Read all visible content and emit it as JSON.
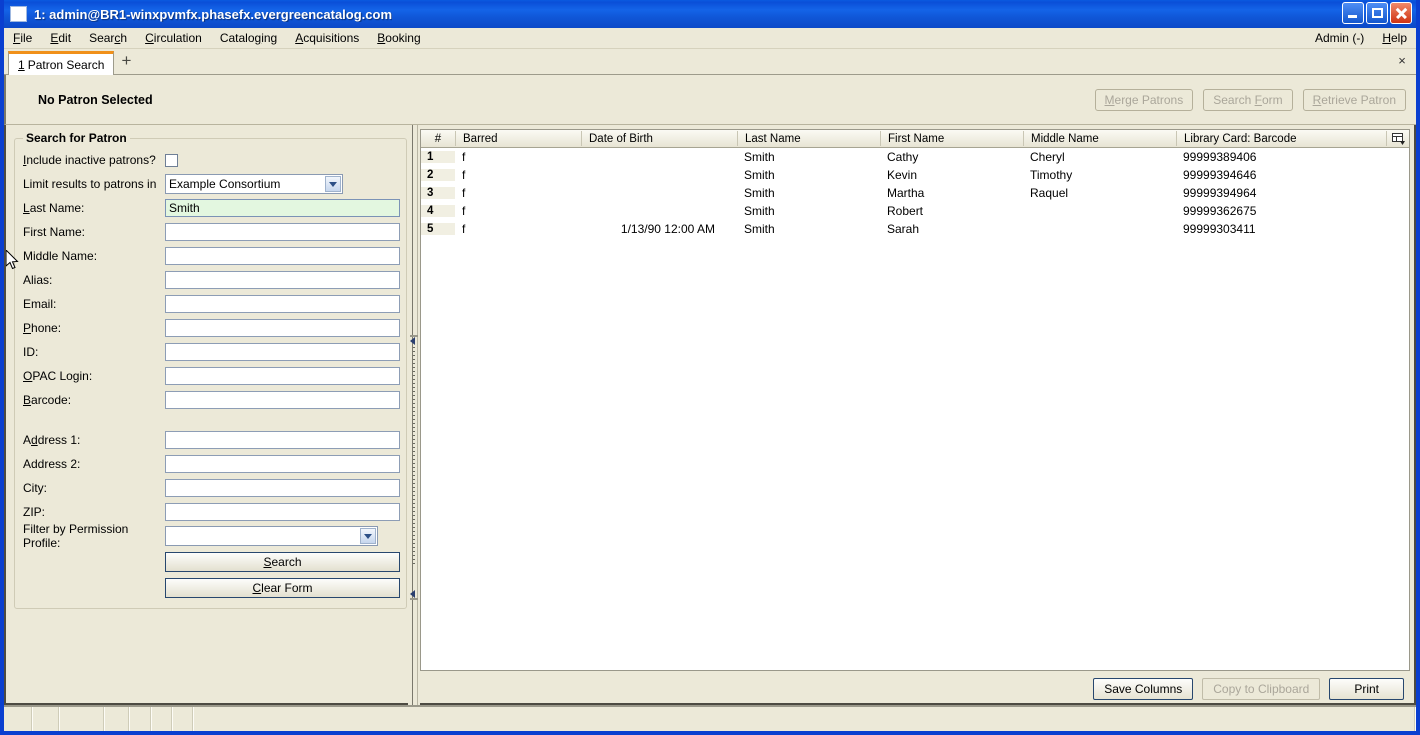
{
  "window": {
    "title": "1: admin@BR1-winxpvmfx.phasefx.evergreencatalog.com",
    "minimize_label": "Minimize",
    "maximize_label": "Maximize",
    "close_label": "Close"
  },
  "menubar": {
    "items": [
      {
        "label": "File",
        "accel": "F"
      },
      {
        "label": "Edit",
        "accel": "E"
      },
      {
        "label": "Search",
        "accel": "c"
      },
      {
        "label": "Circulation",
        "accel": "C"
      },
      {
        "label": "Cataloging",
        "accel": "g"
      },
      {
        "label": "Acquisitions",
        "accel": "A"
      },
      {
        "label": "Booking",
        "accel": "B"
      }
    ],
    "right_items": [
      {
        "label": "Admin (-)"
      },
      {
        "label": "Help"
      }
    ]
  },
  "tabs": {
    "items": [
      {
        "number": "1",
        "label": "Patron Search"
      }
    ],
    "new_tab_label": "+",
    "close_label": "×"
  },
  "patron_bar": {
    "title": "No Patron Selected",
    "buttons": [
      {
        "label": "Merge Patrons",
        "disabled": true
      },
      {
        "label": "Search Form",
        "disabled": true
      },
      {
        "label": "Retrieve Patron",
        "disabled": true
      }
    ]
  },
  "search_form": {
    "legend": "Search for Patron",
    "include_inactive_label": "Include inactive patrons?",
    "include_inactive_checked": false,
    "limit_results_label": "Limit results to patrons in",
    "limit_results_value": "Example Consortium",
    "fields": [
      {
        "label": "Last Name:",
        "value": "Smith",
        "placeholder": "",
        "focused": true
      },
      {
        "label": "First Name:",
        "value": "",
        "placeholder": "",
        "focused": false
      },
      {
        "label": "Middle Name:",
        "value": "",
        "placeholder": "",
        "focused": false
      },
      {
        "label": "Alias:",
        "value": "",
        "placeholder": "",
        "focused": false
      },
      {
        "label": "Email:",
        "value": "",
        "placeholder": "",
        "focused": false
      },
      {
        "label": "Phone:",
        "value": "",
        "placeholder": "",
        "focused": false
      },
      {
        "label": "ID:",
        "value": "",
        "placeholder": "",
        "focused": false
      },
      {
        "label": "OPAC Login:",
        "value": "",
        "placeholder": "",
        "focused": false
      },
      {
        "label": "Barcode:",
        "value": "",
        "placeholder": "",
        "focused": false
      }
    ],
    "address_fields": [
      {
        "label": "Address 1:",
        "value": "",
        "placeholder": ""
      },
      {
        "label": "Address 2:",
        "value": "",
        "placeholder": ""
      },
      {
        "label": "City:",
        "value": "",
        "placeholder": ""
      },
      {
        "label": "ZIP:",
        "value": "",
        "placeholder": ""
      }
    ],
    "permission_profile_label": "Filter by Permission Profile:",
    "permission_profile_value": "",
    "search_button": "Search",
    "clear_button": "Clear Form"
  },
  "results": {
    "columns": [
      {
        "key": "num",
        "label": "#"
      },
      {
        "key": "barred",
        "label": "Barred"
      },
      {
        "key": "dob",
        "label": "Date of Birth"
      },
      {
        "key": "last",
        "label": "Last Name"
      },
      {
        "key": "first",
        "label": "First Name"
      },
      {
        "key": "middle",
        "label": "Middle Name"
      },
      {
        "key": "card",
        "label": "Library Card: Barcode"
      }
    ],
    "column_picker_icon": "column-picker-icon",
    "rows": [
      {
        "num": "1",
        "barred": "f",
        "dob": "",
        "last": "Smith",
        "first": "Cathy",
        "middle": "Cheryl",
        "card": "99999389406"
      },
      {
        "num": "2",
        "barred": "f",
        "dob": "",
        "last": "Smith",
        "first": "Kevin",
        "middle": "Timothy",
        "card": "99999394646"
      },
      {
        "num": "3",
        "barred": "f",
        "dob": "",
        "last": "Smith",
        "first": "Martha",
        "middle": "Raquel",
        "card": "99999394964"
      },
      {
        "num": "4",
        "barred": "f",
        "dob": "",
        "last": "Smith",
        "first": "Robert",
        "middle": "",
        "card": "99999362675"
      },
      {
        "num": "5",
        "barred": "f",
        "dob": "1/13/90 12:00 AM",
        "last": "Smith",
        "first": "Sarah",
        "middle": "",
        "card": "99999303411"
      }
    ],
    "footer_buttons": [
      {
        "label": "Save Columns",
        "disabled": false
      },
      {
        "label": "Copy to Clipboard",
        "disabled": true
      },
      {
        "label": "Print",
        "disabled": false
      }
    ]
  },
  "colors": {
    "window_chrome": "#ece9d8",
    "title_blue": "#1457cd",
    "tab_accent": "#f0901a",
    "focused_field_bg": "#e3f7e0",
    "grid_header_bg": "#eeebdb"
  }
}
